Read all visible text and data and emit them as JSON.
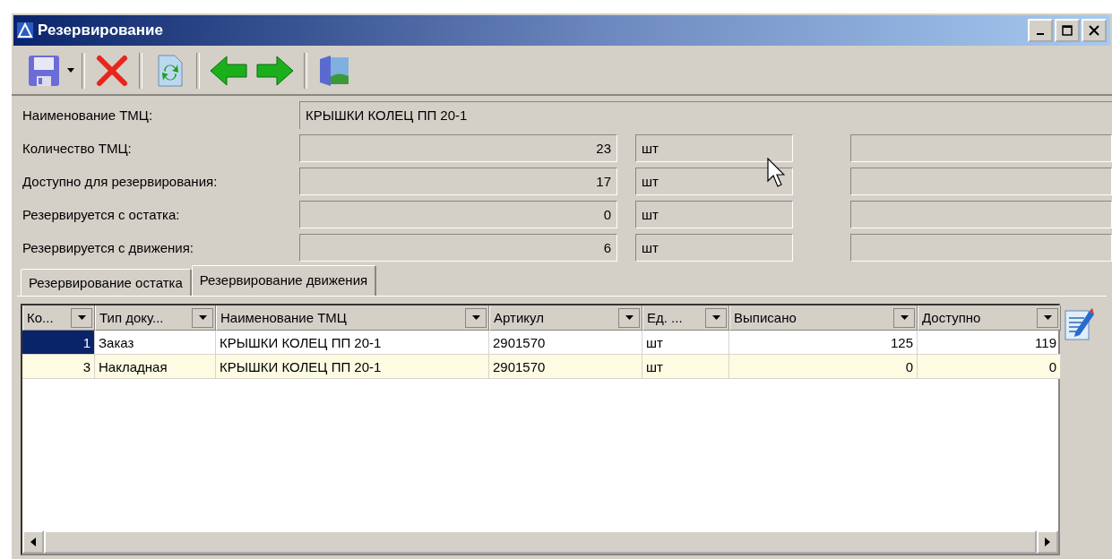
{
  "window": {
    "title": "Резервирование"
  },
  "toolbar": [
    {
      "kind": "save"
    },
    {
      "kind": "dropdown"
    },
    {
      "kind": "delete"
    },
    {
      "kind": "refresh"
    },
    {
      "kind": "back"
    },
    {
      "kind": "forward"
    },
    {
      "kind": "exit"
    }
  ],
  "name_field": {
    "label": "Наименование ТМЦ:",
    "value": "КРЫШКИ КОЛЕЦ ПП 20-1"
  },
  "quantity_fields": [
    {
      "label": "Количество ТМЦ:",
      "value": "23",
      "unit": "шт"
    },
    {
      "label": "Доступно для резервирования:",
      "value": "17",
      "unit": "шт"
    },
    {
      "label": "Резервируется с остатка:",
      "value": "0",
      "unit": "шт"
    },
    {
      "label": "Резервируется с движения:",
      "value": "6",
      "unit": "шт"
    }
  ],
  "tabs": [
    {
      "label": "Резервирование остатка",
      "selected": false
    },
    {
      "label": "Резервирование движения",
      "selected": true
    }
  ],
  "table": {
    "columns": [
      "Ко...",
      "Тип доку...",
      "Наименование ТМЦ",
      "Артикул",
      "Ед. ...",
      "Выписано",
      "Доступно"
    ],
    "rows": [
      {
        "selected": true,
        "cells": [
          "1",
          "Заказ",
          "КРЫШКИ КОЛЕЦ ПП 20-1",
          "2901570",
          "шт",
          "125",
          "119"
        ]
      },
      {
        "selected": false,
        "cells": [
          "3",
          "Накладная",
          "КРЫШКИ КОЛЕЦ ПП 20-1",
          "2901570",
          "шт",
          "0",
          "0"
        ]
      }
    ]
  }
}
